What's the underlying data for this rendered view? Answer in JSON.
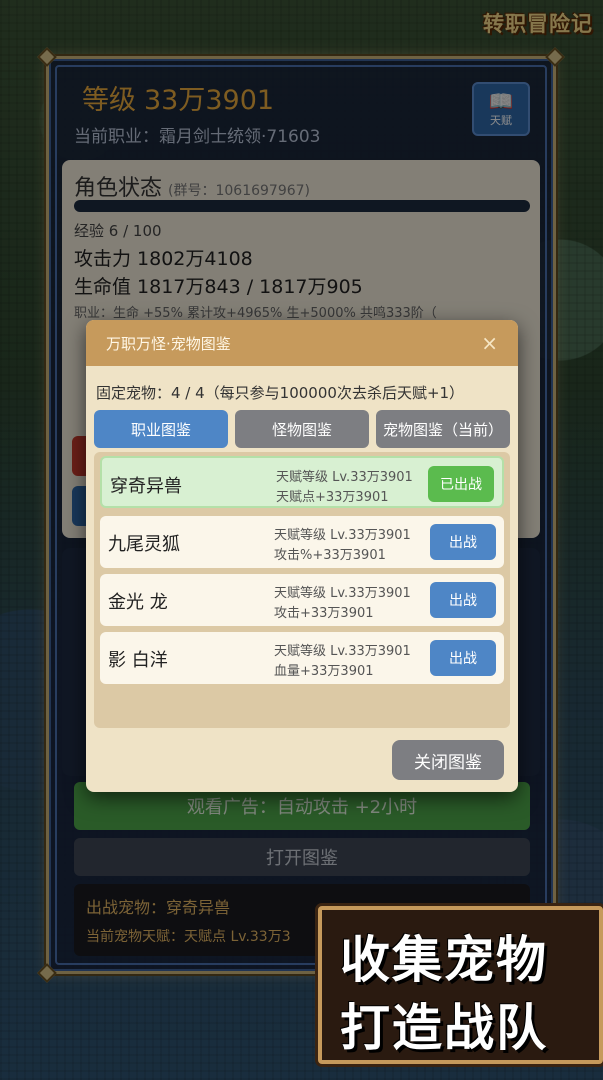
{
  "app": {
    "logo": "转职冒险记"
  },
  "header": {
    "level_label": "等级",
    "level_value": "33万3901",
    "job_line": "当前职业：霜月剑士统领·71603",
    "talent_button": "天赋"
  },
  "status": {
    "title": "角色状态",
    "group_no": "(群号：1061697967)",
    "exp": "经验 6 / 100",
    "attack": "攻击力  1802万4108",
    "hp": "生命值  1817万843 / 1817万905",
    "bonus_line": "职业：生命 +55%  累计攻+4965% 生+5000% 共鸣333阶（"
  },
  "background_buttons": {
    "watch_ad": "观看广告：自动攻击 +2小时",
    "open_guide": "打开图鉴",
    "pet_out": "出战宠物：穿奇异兽",
    "pet_talent": "当前宠物天赋：天赋点 Lv.33万3"
  },
  "modal": {
    "title": "万职万怪·宠物图鉴",
    "close_icon": "×",
    "fixed_pets": "固定宠物：4 / 4（每只参与100000次去杀后天赋+1）",
    "tabs": [
      {
        "label": "职业图鉴",
        "active": true
      },
      {
        "label": "怪物图鉴",
        "active": false
      },
      {
        "label": "宠物图鉴（当前）",
        "active": false
      }
    ],
    "pets": [
      {
        "name": "穿奇异兽",
        "level": "天赋等级 Lv.33万3901",
        "bonus": "  天赋点+33万3901",
        "button": "已出战",
        "owned": true
      },
      {
        "name": "九尾灵狐",
        "level": "天赋等级 Lv.33万3901",
        "bonus": "  攻击%+33万3901",
        "button": "出战",
        "owned": false
      },
      {
        "name": "金光 龙",
        "level": "天赋等级 Lv.33万3901",
        "bonus": "  攻击+33万3901",
        "button": "出战",
        "owned": false
      },
      {
        "name": "影  白洋",
        "level": "天赋等级 Lv.33万3901",
        "bonus": "  血量+33万3901",
        "button": "出战",
        "owned": false
      }
    ],
    "close_button": "关闭图鉴"
  },
  "promo": {
    "line1": "收集宠物",
    "line2": "打造战队"
  },
  "colors": {
    "accent_blue": "#4e86c6",
    "accent_green": "#5bbb4e",
    "gold": "#e6a83c",
    "modal_header": "#c69a5c"
  }
}
